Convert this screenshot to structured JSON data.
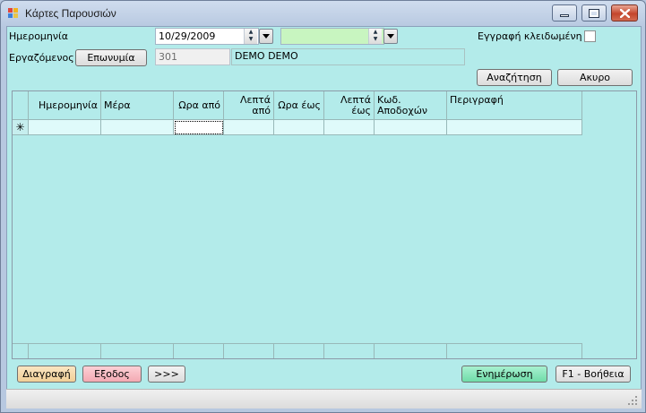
{
  "window": {
    "title": "Κάρτες Παρουσιών",
    "icon": "app-window-icon",
    "controls": {
      "minimize": "minimize-icon",
      "maximize": "maximize-icon",
      "close": "close-icon"
    }
  },
  "filters": {
    "date_label": "Ημερομηνία",
    "date_from_value": "10/29/2009",
    "date_to_value": "",
    "locked_label": "Εγγραφή κλειδωμένη",
    "locked_checked": false,
    "employee_label": "Εργαζόμενος",
    "surname_button": "Επωνυμία",
    "employee_code": "301",
    "employee_name": "DEMO DEMO",
    "search_button": "Αναζήτηση",
    "cancel_button": "Ακυρο"
  },
  "grid": {
    "columns": [
      "Ημερομηνία",
      "Μέρα",
      "Ωρα από",
      "Λεπτά από",
      "Ωρα έως",
      "Λεπτά έως",
      "Κωδ. Αποδοχών",
      "Περιγραφή"
    ],
    "new_row_marker": "✳"
  },
  "footer": {
    "delete_button": "Διαγραφή",
    "exit_button": "Εξοδος",
    "next_button": ">>>",
    "update_button": "Ενημέρωση",
    "help_button": "F1 - Βοήθεια"
  },
  "colors": {
    "client_bg": "#b3ebea",
    "date_to_bg": "#c8f5c0",
    "delete_bg": "#f7d9a8",
    "exit_bg": "#f7b7bf",
    "update_bg": "#7fe6b8"
  }
}
